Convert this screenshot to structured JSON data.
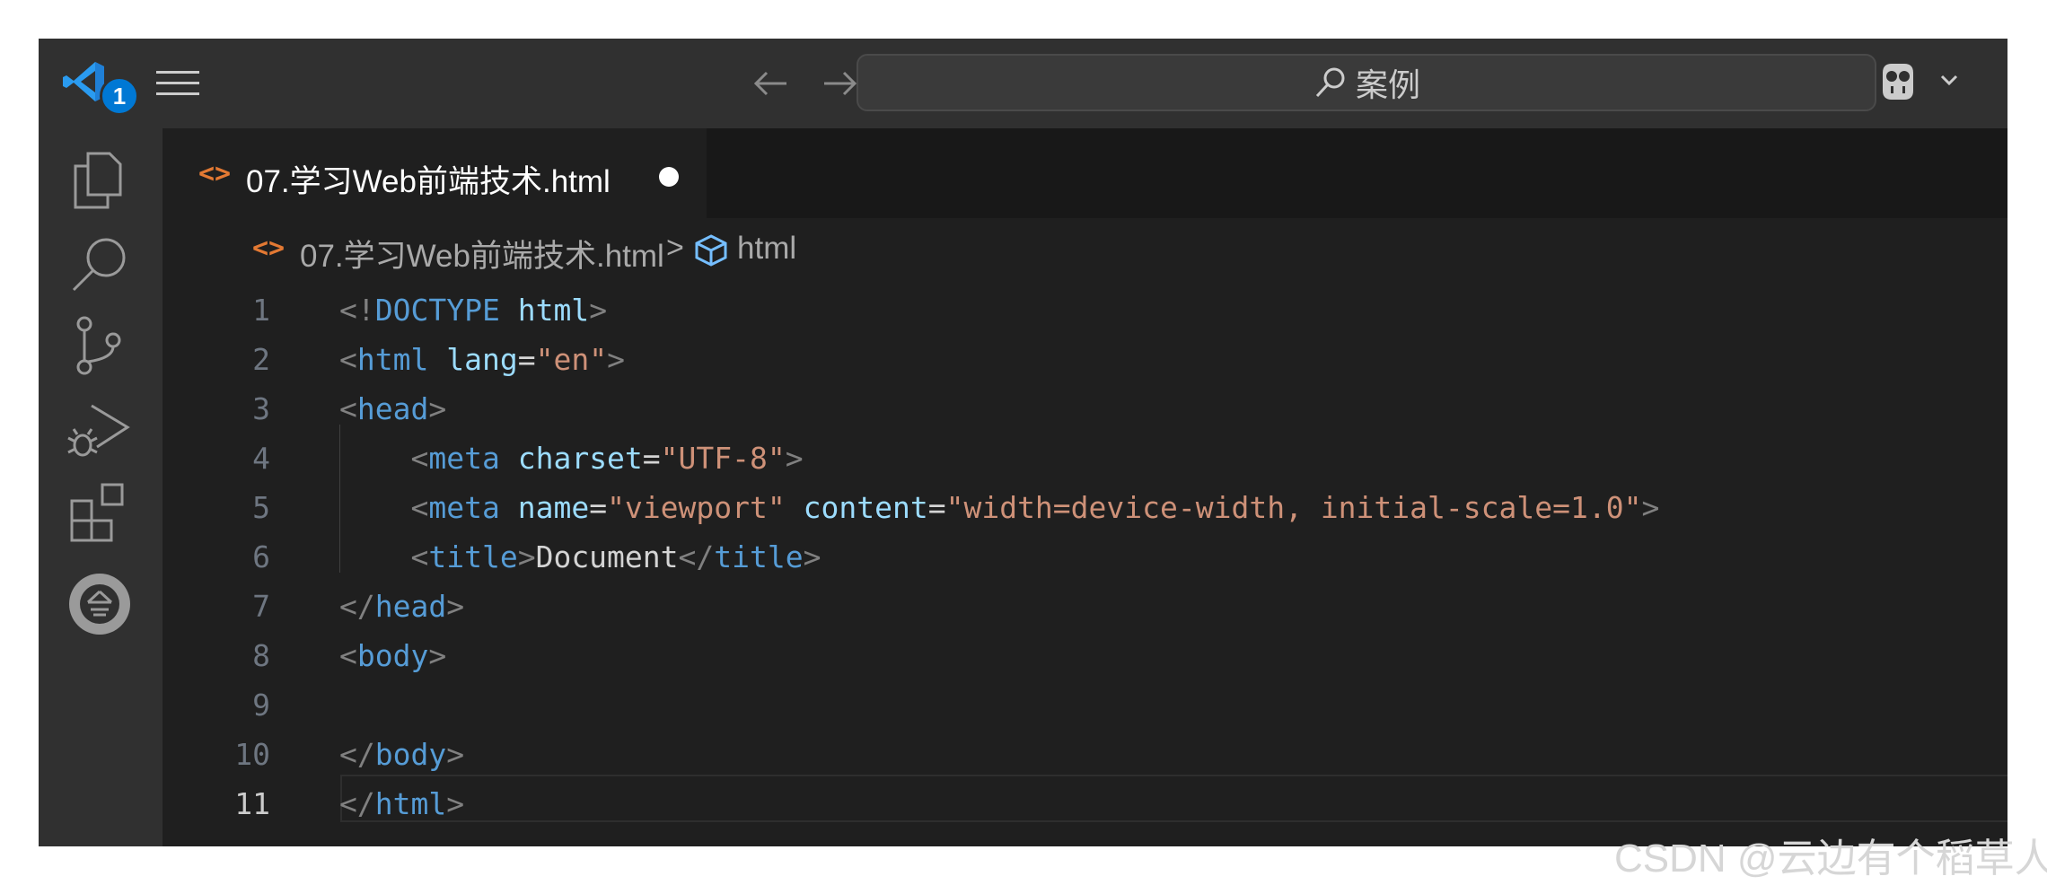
{
  "command_center": {
    "label": "案例"
  },
  "tab": {
    "icon": "<>",
    "label": "07.学习Web前端技术.html"
  },
  "breadcrumb": {
    "file_icon": "<>",
    "file": "07.学习Web前端技术.html",
    "separator": ">",
    "symbol": "html"
  },
  "activity": {
    "explorer_badge": "1"
  },
  "editor": {
    "line_numbers": [
      "1",
      "2",
      "3",
      "4",
      "5",
      "6",
      "7",
      "8",
      "9",
      "10",
      "11"
    ],
    "active_line": "11",
    "lines": [
      [
        {
          "c": "p",
          "v": "<!"
        },
        {
          "c": "t",
          "v": "DOCTYPE"
        },
        {
          "c": "x",
          "v": " "
        },
        {
          "c": "a",
          "v": "html"
        },
        {
          "c": "p",
          "v": ">"
        }
      ],
      [
        {
          "c": "p",
          "v": "<"
        },
        {
          "c": "t",
          "v": "html"
        },
        {
          "c": "x",
          "v": " "
        },
        {
          "c": "a",
          "v": "lang"
        },
        {
          "c": "x",
          "v": "="
        },
        {
          "c": "s",
          "v": "\"en\""
        },
        {
          "c": "p",
          "v": ">"
        }
      ],
      [
        {
          "c": "p",
          "v": "<"
        },
        {
          "c": "t",
          "v": "head"
        },
        {
          "c": "p",
          "v": ">"
        }
      ],
      [
        {
          "c": "x",
          "v": "    "
        },
        {
          "c": "p",
          "v": "<"
        },
        {
          "c": "t",
          "v": "meta"
        },
        {
          "c": "x",
          "v": " "
        },
        {
          "c": "a",
          "v": "charset"
        },
        {
          "c": "x",
          "v": "="
        },
        {
          "c": "s",
          "v": "\"UTF-8\""
        },
        {
          "c": "p",
          "v": ">"
        }
      ],
      [
        {
          "c": "x",
          "v": "    "
        },
        {
          "c": "p",
          "v": "<"
        },
        {
          "c": "t",
          "v": "meta"
        },
        {
          "c": "x",
          "v": " "
        },
        {
          "c": "a",
          "v": "name"
        },
        {
          "c": "x",
          "v": "="
        },
        {
          "c": "s",
          "v": "\"viewport\""
        },
        {
          "c": "x",
          "v": " "
        },
        {
          "c": "a",
          "v": "content"
        },
        {
          "c": "x",
          "v": "="
        },
        {
          "c": "s",
          "v": "\"width=device-width, initial-scale=1.0\""
        },
        {
          "c": "p",
          "v": ">"
        }
      ],
      [
        {
          "c": "x",
          "v": "    "
        },
        {
          "c": "p",
          "v": "<"
        },
        {
          "c": "t",
          "v": "title"
        },
        {
          "c": "p",
          "v": ">"
        },
        {
          "c": "x",
          "v": "Document"
        },
        {
          "c": "p",
          "v": "</"
        },
        {
          "c": "t",
          "v": "title"
        },
        {
          "c": "p",
          "v": ">"
        }
      ],
      [
        {
          "c": "p",
          "v": "</"
        },
        {
          "c": "t",
          "v": "head"
        },
        {
          "c": "p",
          "v": ">"
        }
      ],
      [
        {
          "c": "p",
          "v": "<"
        },
        {
          "c": "t",
          "v": "body"
        },
        {
          "c": "p",
          "v": ">"
        }
      ],
      [],
      [
        {
          "c": "p",
          "v": "</"
        },
        {
          "c": "t",
          "v": "body"
        },
        {
          "c": "p",
          "v": ">"
        }
      ],
      [
        {
          "c": "p",
          "v": "</"
        },
        {
          "c": "t",
          "v": "html"
        },
        {
          "c": "p",
          "v": ">"
        }
      ]
    ]
  },
  "watermark": "CSDN @云边有个稻草人",
  "icons": {
    "logo": "vscode-logo-icon",
    "menu": "hamburger-menu-icon",
    "back": "arrow-left-icon",
    "forward": "arrow-right-icon",
    "search": "search-icon",
    "copilot": "copilot-icon",
    "activity": [
      "files-icon",
      "search-icon",
      "source-control-icon",
      "run-debug-icon",
      "extensions-icon",
      "accounts-icon"
    ]
  },
  "colors": {
    "accent_blue": "#0078d4",
    "logo_blue": "#2a9bf0",
    "tag": "#569cd6",
    "attribute": "#9cdcfe",
    "string": "#ce9178",
    "punctuation": "#808080",
    "html_icon": "#e37933"
  }
}
